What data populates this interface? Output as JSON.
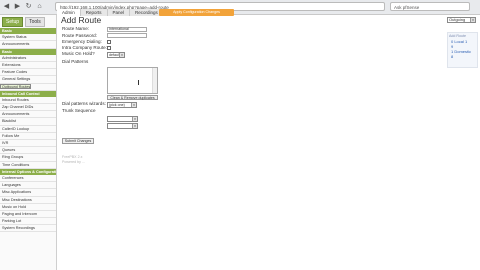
{
  "browser": {
    "back": "◀",
    "forward": "▶",
    "reload": "↻",
    "home": "⌂",
    "url": "http://192.168.1.100/admin/index.php?page=add-route",
    "search_placeholder": "Ask pfSense"
  },
  "sidebar": {
    "tabs": [
      {
        "label": "Setup"
      },
      {
        "label": "Tools"
      }
    ],
    "items": [
      {
        "kind": "head",
        "label": "Basic"
      },
      {
        "kind": "item",
        "label": "System Status"
      },
      {
        "kind": "item",
        "label": "Announcements"
      },
      {
        "kind": "head",
        "label": "Basic"
      },
      {
        "kind": "item",
        "label": "Administrators"
      },
      {
        "kind": "item",
        "label": "Extensions"
      },
      {
        "kind": "item",
        "label": "Feature Codes"
      },
      {
        "kind": "item",
        "label": "General Settings"
      },
      {
        "kind": "item",
        "label": "Outbound Routes",
        "selected": true
      },
      {
        "kind": "item",
        "label": "Trunks"
      },
      {
        "kind": "head",
        "label": "Inbound Call Control"
      },
      {
        "kind": "item",
        "label": "Inbound Routes"
      },
      {
        "kind": "item",
        "label": "Zap Channel DIDs"
      },
      {
        "kind": "item",
        "label": "Announcements"
      },
      {
        "kind": "item",
        "label": "Blacklist"
      },
      {
        "kind": "item",
        "label": "CallerID Lookup"
      },
      {
        "kind": "item",
        "label": "Follow Me"
      },
      {
        "kind": "item",
        "label": "IVR"
      },
      {
        "kind": "item",
        "label": "Queues"
      },
      {
        "kind": "item",
        "label": "Ring Groups"
      },
      {
        "kind": "item",
        "label": "Time Conditions"
      },
      {
        "kind": "head",
        "label": "Internal Options & Configuration"
      },
      {
        "kind": "item",
        "label": "Conferences"
      },
      {
        "kind": "item",
        "label": "Languages"
      },
      {
        "kind": "item",
        "label": "Misc Applications"
      },
      {
        "kind": "item",
        "label": "Misc Destinations"
      },
      {
        "kind": "item",
        "label": "Music on Hold"
      },
      {
        "kind": "item",
        "label": "Paging and Intercom"
      },
      {
        "kind": "item",
        "label": "Parking Lot"
      },
      {
        "kind": "item",
        "label": "System Recordings"
      }
    ]
  },
  "topmenu": {
    "items": [
      {
        "label": "Admin",
        "active": true
      },
      {
        "label": "Reports"
      },
      {
        "label": "Panel"
      },
      {
        "label": "Recordings"
      },
      {
        "label": "Help"
      }
    ],
    "orange_label": "Apply Configuration Changes"
  },
  "form": {
    "title": "Add Route",
    "labels": {
      "route_name": "Route Name:",
      "route_password": "Route Password:",
      "emergency_dialing": "Emergency Dialing:",
      "intra_company": "Intra Company Route:",
      "music_on_hold": "Music On Hold?",
      "dial_patterns": "Dial Patterns",
      "dial_rules_wizards": "Dial patterns wizards:",
      "trunk_sequence": "Trunk Sequence"
    },
    "route_name_value": "International",
    "route_password_value": "",
    "music_on_hold_value": "default",
    "clean_button": "Clean & Remove duplicates",
    "wizard_value": "(pick one)",
    "submit_button": "Submit Changes"
  },
  "footer": {
    "line1": "FreePBX 2.x",
    "line2": "Powered by ..."
  },
  "right": {
    "dropdown_value": "Outgoing",
    "box_header": "Add Route",
    "links": [
      "0 Local 1",
      "9",
      "1 Domestic",
      "8"
    ]
  }
}
